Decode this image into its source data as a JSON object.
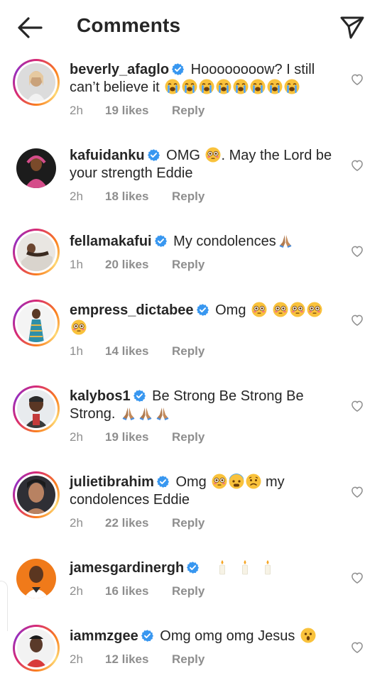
{
  "header": {
    "title": "Comments"
  },
  "comments": [
    {
      "username": "beverly_afaglo",
      "text": "Hoooooooow? I still can’t believe it",
      "time": "2h",
      "likes": "19 likes",
      "reply": "Reply"
    },
    {
      "username": "kafuidanku",
      "text": "OMG",
      "text2": ". May the Lord be your strength Eddie",
      "time": "2h",
      "likes": "18 likes",
      "reply": "Reply"
    },
    {
      "username": "fellamakafui",
      "text": "My condolences",
      "time": "1h",
      "likes": "20 likes",
      "reply": "Reply"
    },
    {
      "username": "empress_dictabee",
      "text": "Omg",
      "time": "1h",
      "likes": "14 likes",
      "reply": "Reply"
    },
    {
      "username": "kalybos1",
      "text": "Be Strong Be Strong Be Strong.",
      "time": "2h",
      "likes": "19 likes",
      "reply": "Reply"
    },
    {
      "username": "julietibrahim",
      "text": "Omg",
      "text2": "my condolences Eddie",
      "time": "2h",
      "likes": "22 likes",
      "reply": "Reply"
    },
    {
      "username": "jamesgardinergh",
      "text": "",
      "time": "2h",
      "likes": "16 likes",
      "reply": "Reply"
    },
    {
      "username": "iammzgee",
      "text": "Omg omg omg Jesus",
      "time": "2h",
      "likes": "12 likes",
      "reply": "Reply"
    }
  ],
  "icons": {
    "back": "arrow-left-icon",
    "send": "paper-plane-icon",
    "verified": "verified-badge-icon",
    "like": "heart-outline-icon"
  },
  "colors": {
    "verified": "#3897f0",
    "text": "#262626",
    "muted": "#8e8e8e"
  }
}
